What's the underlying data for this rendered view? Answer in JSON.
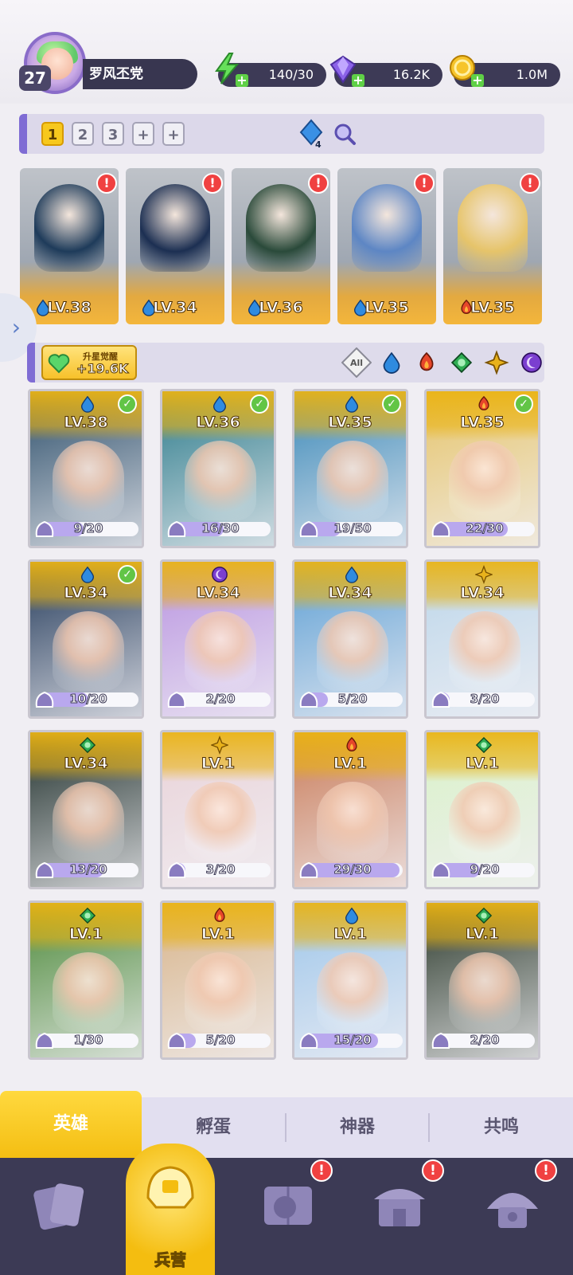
{
  "player": {
    "level": "27",
    "name": "罗风丕党"
  },
  "resources": {
    "energy": {
      "value": "140/30",
      "icon": "lightning-icon"
    },
    "gems": {
      "value": "16.2K",
      "icon": "gem-icon"
    },
    "coins": {
      "value": "1.0M",
      "icon": "coin-icon"
    }
  },
  "team": {
    "tabs": [
      "1",
      "2",
      "3",
      "+",
      "+"
    ],
    "active_tab": "1",
    "power_badge": "4"
  },
  "deployed": [
    {
      "level": "LV.38",
      "element": "water",
      "alert": "!"
    },
    {
      "level": "LV.34",
      "element": "water",
      "alert": "!"
    },
    {
      "level": "LV.36",
      "element": "water",
      "alert": "!"
    },
    {
      "level": "LV.35",
      "element": "water",
      "alert": "!"
    },
    {
      "level": "LV.35",
      "element": "fire",
      "alert": "!"
    }
  ],
  "awakening": {
    "label": "升星觉醒",
    "value": "+19.6K"
  },
  "filters": [
    "All",
    "water",
    "fire",
    "wind",
    "light",
    "dark"
  ],
  "heroes": [
    {
      "level": "LV.38",
      "element": "water",
      "shards": "9/20",
      "progress": 0.45,
      "checked": true
    },
    {
      "level": "LV.36",
      "element": "water",
      "shards": "16/30",
      "progress": 0.53,
      "checked": true
    },
    {
      "level": "LV.35",
      "element": "water",
      "shards": "19/50",
      "progress": 0.38,
      "checked": true
    },
    {
      "level": "LV.35",
      "element": "fire",
      "shards": "22/30",
      "progress": 0.73,
      "checked": true
    },
    {
      "level": "LV.34",
      "element": "water",
      "shards": "10/20",
      "progress": 0.5,
      "checked": true
    },
    {
      "level": "LV.34",
      "element": "dark",
      "shards": "2/20",
      "progress": 0.1,
      "checked": false
    },
    {
      "level": "LV.34",
      "element": "water",
      "shards": "5/20",
      "progress": 0.25,
      "checked": false
    },
    {
      "level": "LV.34",
      "element": "light",
      "shards": "3/20",
      "progress": 0.15,
      "checked": false
    },
    {
      "level": "LV.34",
      "element": "wind",
      "shards": "13/20",
      "progress": 0.65,
      "checked": false
    },
    {
      "level": "LV.1",
      "element": "light",
      "shards": "3/20",
      "progress": 0.15,
      "checked": false
    },
    {
      "level": "LV.1",
      "element": "fire",
      "shards": "29/30",
      "progress": 0.97,
      "checked": false
    },
    {
      "level": "LV.1",
      "element": "wind",
      "shards": "9/20",
      "progress": 0.45,
      "checked": false
    },
    {
      "level": "LV.1",
      "element": "wind",
      "shards": "1/30",
      "progress": 0.03,
      "checked": false
    },
    {
      "level": "LV.1",
      "element": "fire",
      "shards": "5/20",
      "progress": 0.25,
      "checked": false
    },
    {
      "level": "LV.1",
      "element": "water",
      "shards": "15/20",
      "progress": 0.75,
      "checked": false
    },
    {
      "level": "LV.1",
      "element": "wind",
      "shards": "2/20",
      "progress": 0.1,
      "checked": false
    }
  ],
  "tabs": [
    "英雄",
    "孵蛋",
    "神器",
    "共鸣"
  ],
  "nav": {
    "active_label": "兵营",
    "alert": "!"
  },
  "colors": {
    "water": "#2f8be0",
    "fire": "#e6462a",
    "wind": "#2fae53",
    "light": "#e8b21b",
    "dark": "#7b3fd0",
    "accent": "#f4be12",
    "nav_bg": "#3c3a55"
  }
}
